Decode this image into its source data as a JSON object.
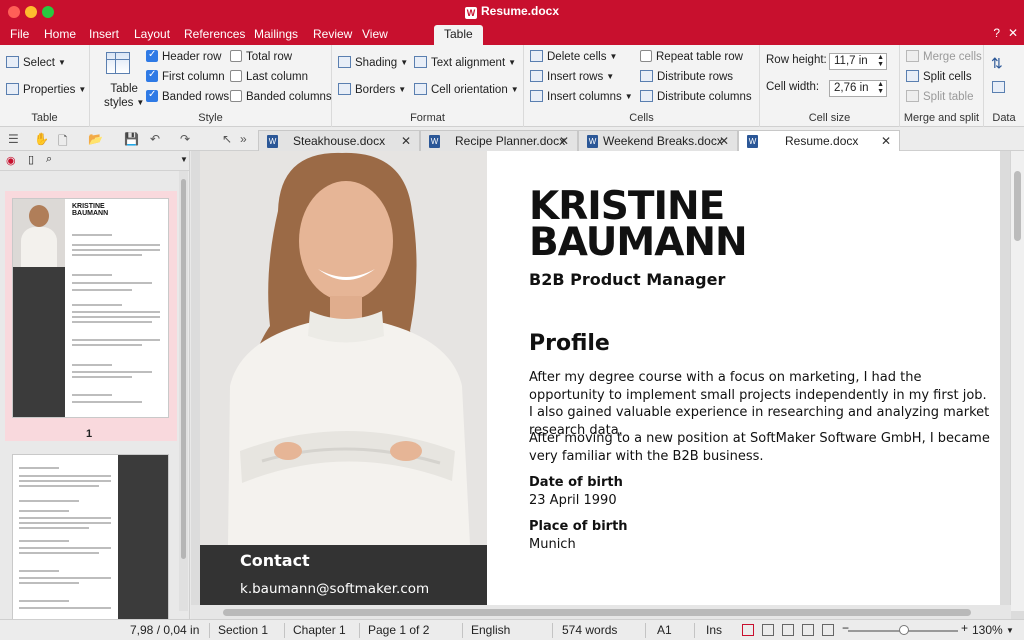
{
  "window": {
    "title": "Resume.docx"
  },
  "menu": {
    "items": [
      "File",
      "Home",
      "Insert",
      "Layout",
      "References",
      "Mailings",
      "Review",
      "View",
      "Table"
    ],
    "help": "?",
    "close": "✕"
  },
  "ribbon": {
    "table": {
      "select": "Select",
      "properties": "Properties",
      "label": "Table"
    },
    "style": {
      "table_styles": [
        "Table",
        "styles"
      ],
      "header_row": "Header row",
      "first_column": "First column",
      "banded_rows": "Banded rows",
      "total_row": "Total row",
      "last_column": "Last column",
      "banded_columns": "Banded columns",
      "label": "Style"
    },
    "format": {
      "shading": "Shading",
      "borders": "Borders",
      "text_alignment": "Text alignment",
      "cell_orientation": "Cell orientation",
      "label": "Format"
    },
    "cells": {
      "delete_cells": "Delete cells",
      "insert_rows": "Insert rows",
      "insert_columns": "Insert columns",
      "repeat_table_row": "Repeat table row",
      "distribute_rows": "Distribute rows",
      "distribute_columns": "Distribute columns",
      "label": "Cells"
    },
    "cell_size": {
      "row_height_label": "Row height:",
      "row_height_value": "11,7 in",
      "cell_width_label": "Cell width:",
      "cell_width_value": "2,76 in",
      "label": "Cell size"
    },
    "merge": {
      "merge_cells": "Merge cells",
      "split_cells": "Split cells",
      "split_table": "Split table",
      "label": "Merge and split"
    },
    "data": {
      "label": "Data"
    }
  },
  "tabs": [
    {
      "label": "Steakhouse.docx"
    },
    {
      "label": "Recipe Planner.docx"
    },
    {
      "label": "Weekend Breaks.docx"
    },
    {
      "label": "Resume.docx"
    }
  ],
  "sidebar": {
    "page1_number": "1",
    "thumb_name": [
      "KRISTINE",
      "BAUMANN"
    ]
  },
  "resume": {
    "name_line1": "KRISTINE",
    "name_line2": "BAUMANN",
    "subtitle": "B2B Product Manager",
    "profile_heading": "Profile",
    "profile_p1": "After my degree course with a focus on marketing, I had the opportunity to implement small projects independently in my first job. I also gained valuable experience in researching and analyzing market research data.",
    "profile_p2": "After moving to a new position at SoftMaker Software GmbH, I became very familiar with the B2B business.",
    "dob_label": "Date of birth",
    "dob_value": "23 April 1990",
    "pob_label": "Place of birth",
    "pob_value": "Munich",
    "contact_heading": "Contact",
    "contact_email": "k.baumann@softmaker.com"
  },
  "status": {
    "position": "7,98 / 0,04 in",
    "section": "Section 1",
    "chapter": "Chapter 1",
    "page": "Page 1 of 2",
    "language": "English",
    "words": "574 words",
    "cell": "A1",
    "mode": "Ins",
    "zoom": "130%",
    "zoom_minus": "−",
    "zoom_plus": "+"
  },
  "colors": {
    "brand": "#c8102e",
    "accent": "#2f7ae5",
    "contact_bg": "#333333"
  }
}
